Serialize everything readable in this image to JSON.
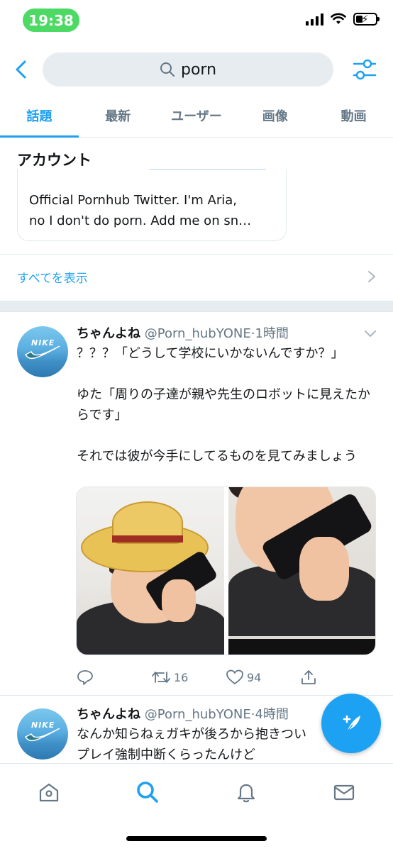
{
  "status_bar": {
    "time": "19:38"
  },
  "search": {
    "query": "porn"
  },
  "tabs": [
    {
      "label": "話題",
      "active": true
    },
    {
      "label": "最新",
      "active": false
    },
    {
      "label": "ユーザー",
      "active": false
    },
    {
      "label": "画像",
      "active": false
    },
    {
      "label": "動画",
      "active": false
    }
  ],
  "accounts": {
    "title": "アカウント",
    "card_bio_line1": "Official Pornhub Twitter. I'm Aria,",
    "card_bio_line2": "no I don't do porn. Add me on sn…",
    "show_all": "すべてを表示"
  },
  "tweets": [
    {
      "name": "ちゃんよね",
      "handle": "@Porn_hubYONE",
      "time": "1時間",
      "text": "？？？「どうして学校にいかないんですか？」\n\nゆた「周りの子達が親や先生のロボットに見えたからです」\n\nそれでは彼が今手にしてるものを見てみましょう",
      "replies": "",
      "retweets": "16",
      "likes": "94"
    },
    {
      "name": "ちゃんよね",
      "handle": "@Porn_hubYONE",
      "time": "4時間",
      "text": "なんか知らねぇガキが後ろから抱きつい\nプレイ強制中断くらったんけど"
    }
  ],
  "icons": {
    "back": "chevron-left-icon",
    "search": "search-icon",
    "filter": "sliders-icon",
    "compose": "compose-tweet-icon",
    "tabbar": [
      "home-icon",
      "search-icon",
      "notifications-icon",
      "messages-icon"
    ]
  },
  "colors": {
    "accent": "#1da1f2",
    "muted": "#657786",
    "status_pill": "#4cd964"
  }
}
